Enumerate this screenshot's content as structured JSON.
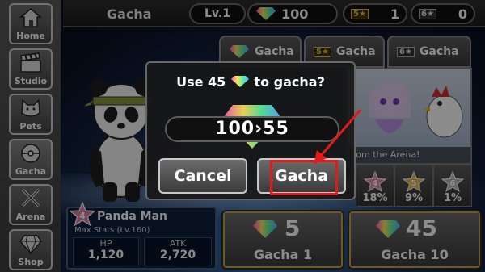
{
  "sidebar": {
    "items": [
      {
        "label": "Home",
        "icon": "home-icon"
      },
      {
        "label": "Studio",
        "icon": "clapperboard-icon"
      },
      {
        "label": "Pets",
        "icon": "cat-icon"
      },
      {
        "label": "Gacha",
        "icon": "gacha-ball-icon"
      },
      {
        "label": "Arena",
        "icon": "crossed-swords-icon"
      },
      {
        "label": "Shop",
        "icon": "diamond-icon"
      }
    ],
    "active": "Gacha"
  },
  "header": {
    "title": "Gacha",
    "level": "Lv.1",
    "gems": "100",
    "ticket5": "1",
    "ticket6": "0",
    "ticket5_label": "5★",
    "ticket6_label": "6★"
  },
  "tabs": [
    {
      "label": "Gacha",
      "icon": "gem-icon"
    },
    {
      "label": "Gacha",
      "icon": "ticket-5-icon",
      "badge": "5★"
    },
    {
      "label": "Gacha",
      "icon": "ticket-6-icon",
      "badge": "6★"
    }
  ],
  "banner": {
    "text": "rom the Arena!"
  },
  "rates": [
    {
      "star": "4",
      "percent": "18%"
    },
    {
      "star": "5",
      "percent": "9%"
    },
    {
      "star": "6",
      "percent": "1%"
    }
  ],
  "dialog": {
    "prefix": "Use 45",
    "suffix": "to gacha?",
    "amount": "100›55",
    "cancel_label": "Cancel",
    "confirm_label": "Gacha"
  },
  "character": {
    "rank": "4",
    "name": "Panda Man",
    "stats_note": "Max Stats (Lv.160)",
    "hp_label": "HP",
    "hp_value": "1,120",
    "atk_label": "ATK",
    "atk_value": "2,720"
  },
  "gacha_buttons": [
    {
      "cost": "5",
      "label": "Gacha 1"
    },
    {
      "cost": "45",
      "label": "Gacha 10"
    }
  ],
  "colors": {
    "highlight": "#e01b1b",
    "gold_border": "#c7a24a"
  }
}
